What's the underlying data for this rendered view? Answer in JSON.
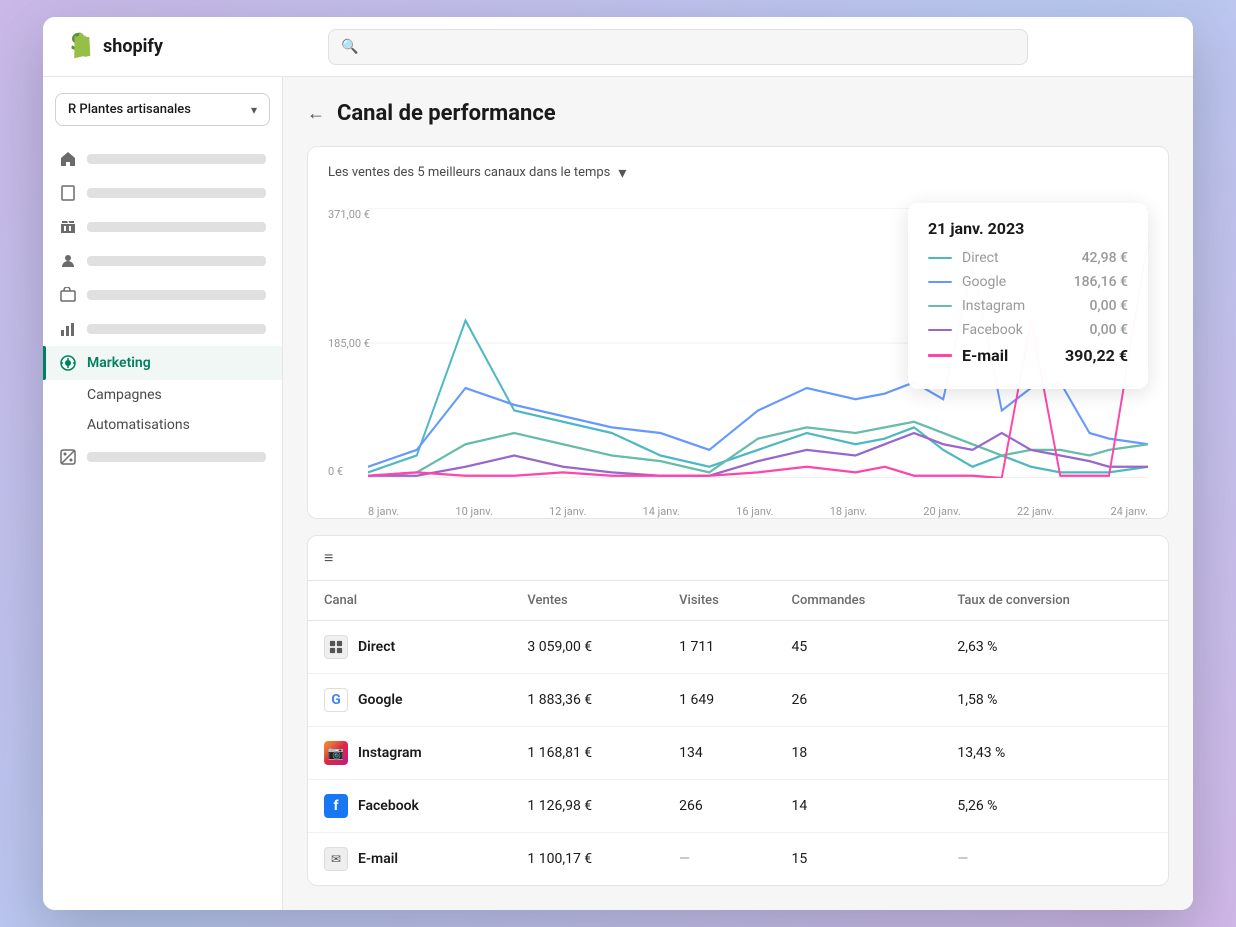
{
  "header": {
    "logo_text": "shopify",
    "search_placeholder": ""
  },
  "sidebar": {
    "store_name": "R Plantes artisanales",
    "nav_items": [
      {
        "id": "home",
        "icon": "home"
      },
      {
        "id": "orders",
        "icon": "inbox"
      },
      {
        "id": "products",
        "icon": "tag"
      },
      {
        "id": "customers",
        "icon": "person"
      },
      {
        "id": "finances",
        "icon": "bank"
      },
      {
        "id": "analytics",
        "icon": "chart"
      },
      {
        "id": "marketing",
        "icon": "marketing",
        "label": "Marketing",
        "active": true
      },
      {
        "id": "discounts",
        "icon": "discount"
      }
    ],
    "sub_items": [
      "Campagnes",
      "Automatisations"
    ]
  },
  "page": {
    "title": "Canal de performance",
    "back_label": "←"
  },
  "chart": {
    "title": "Les ventes des 5 meilleurs canaux dans le temps",
    "y_labels": [
      "371,00 €",
      "185,00 €",
      "0 €"
    ],
    "x_labels": [
      "8 janv.",
      "10 janv.",
      "12 janv.",
      "14 janv.",
      "16 janv.",
      "18 janv.",
      "20 janv.",
      "22 janv.",
      "24 janv."
    ],
    "colors": {
      "direct": "#4db8c4",
      "google": "#6699ff",
      "instagram": "#66bbaa",
      "facebook": "#9966cc",
      "email": "#ff44aa"
    },
    "tooltip": {
      "date": "21 janv. 2023",
      "rows": [
        {
          "channel": "Direct",
          "value": "42,98 €",
          "color": "#4db8c4",
          "highlight": false
        },
        {
          "channel": "Google",
          "value": "186,16 €",
          "color": "#6699ff",
          "highlight": false
        },
        {
          "channel": "Instagram",
          "value": "0,00 €",
          "color": "#66bbaa",
          "highlight": false
        },
        {
          "channel": "Facebook",
          "value": "0,00 €",
          "color": "#9966cc",
          "highlight": false
        },
        {
          "channel": "E-mail",
          "value": "390,22 €",
          "color": "#ff44aa",
          "highlight": true
        }
      ]
    }
  },
  "table": {
    "filter_icon": "≡",
    "columns": [
      "Canal",
      "Ventes",
      "Visites",
      "Commandes",
      "Taux de conversion"
    ],
    "rows": [
      {
        "channel": "Direct",
        "icon_type": "direct",
        "sales": "3 059,00 €",
        "visits": "1 711",
        "orders": "45",
        "conversion": "2,63 %"
      },
      {
        "channel": "Google",
        "icon_type": "google",
        "sales": "1 883,36 €",
        "visits": "1 649",
        "orders": "26",
        "conversion": "1,58 %"
      },
      {
        "channel": "Instagram",
        "icon_type": "instagram",
        "sales": "1 168,81 €",
        "visits": "134",
        "orders": "18",
        "conversion": "13,43 %"
      },
      {
        "channel": "Facebook",
        "icon_type": "facebook",
        "sales": "1 126,98 €",
        "visits": "266",
        "orders": "14",
        "conversion": "5,26 %"
      },
      {
        "channel": "E-mail",
        "icon_type": "email",
        "sales": "1 100,17 €",
        "visits": "—",
        "orders": "15",
        "conversion": "—"
      }
    ]
  }
}
